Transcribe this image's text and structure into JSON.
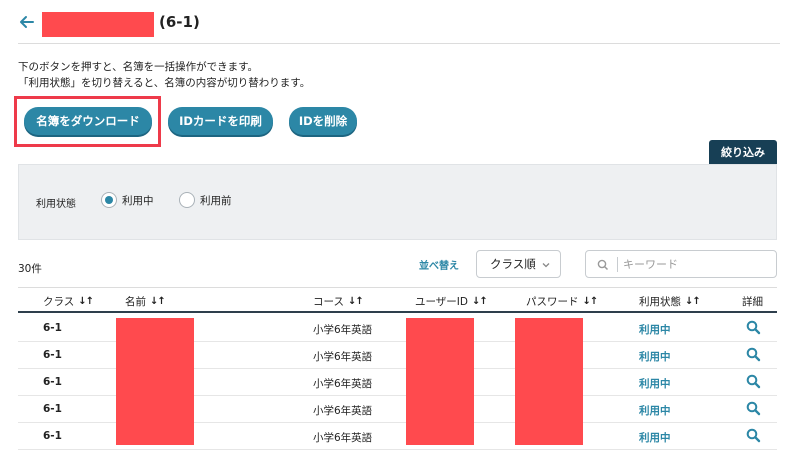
{
  "header": {
    "title_suffix": "(6-1)"
  },
  "description": {
    "line1": "下のボタンを押すと、名簿を一括操作ができます。",
    "line2": "「利用状態」を切り替えると、名簿の内容が切り替わります。"
  },
  "buttons": {
    "download": "名簿をダウンロード",
    "print_id": "IDカードを印刷",
    "delete_id": "IDを削除"
  },
  "filter": {
    "tab_label": "絞り込み",
    "status_label": "利用状態",
    "options": [
      "利用中",
      "利用前"
    ],
    "selected": "利用中"
  },
  "list": {
    "count": "30件",
    "sort_label": "並べ替え",
    "sort_value": "クラス順",
    "search_placeholder": "キーワード"
  },
  "table": {
    "columns": [
      "クラス",
      "名前",
      "コース",
      "ユーザーID",
      "パスワード",
      "利用状態",
      "詳細"
    ],
    "sort_glyph": "↓↑",
    "rows": [
      {
        "class": "6-1",
        "course": "小学6年英語",
        "status": "利用中"
      },
      {
        "class": "6-1",
        "course": "小学6年英語",
        "status": "利用中"
      },
      {
        "class": "6-1",
        "course": "小学6年英語",
        "status": "利用中"
      },
      {
        "class": "6-1",
        "course": "小学6年英語",
        "status": "利用中"
      },
      {
        "class": "6-1",
        "course": "小学6年英語",
        "status": "利用中"
      }
    ]
  },
  "colors": {
    "primary": "#2c87a6",
    "dark_tab": "#173f55",
    "redaction": "#ff4a4e",
    "highlight": "#ee3a4a"
  },
  "icons": [
    "back-arrow-icon",
    "chevron-down-icon",
    "search-icon",
    "detail-search-icon"
  ]
}
